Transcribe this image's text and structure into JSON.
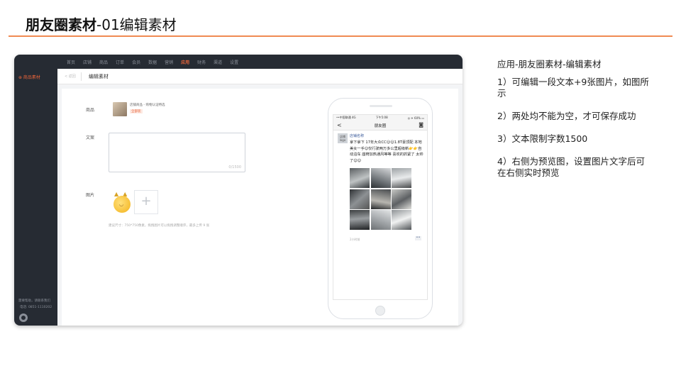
{
  "slide": {
    "title_bold": "朋友圈素材",
    "title_rest": "-01编辑素材"
  },
  "topnav": {
    "items": [
      "首页",
      "店铺",
      "商品",
      "订单",
      "会员",
      "数据",
      "营销",
      "应用",
      "财务",
      "渠道",
      "设置"
    ],
    "active_index": 7
  },
  "sidebar": {
    "item": "⊕ 商品素材",
    "footer_line1": "需要帮助，请联系我们",
    "footer_line2": "电话: 0851-1110202"
  },
  "breadcrumb": {
    "back": "< 返回",
    "title": "编辑素材"
  },
  "form": {
    "goods_label": "商品",
    "goods_name": "店铺商品 - 购物认证特选",
    "goods_tag": "全部装",
    "text_label": "文案",
    "text_value": "",
    "text_counter": "0/1500",
    "image_label": "图片",
    "add_symbol": "+",
    "image_hint": "建议尺寸：750*750像素，拖拽图片可以拖拽调整顺序，最多上传 9 张"
  },
  "preview": {
    "status_left": "••中国联通 4G",
    "status_time": "下午5:08",
    "status_right": "◎ ✈ 60% ▭",
    "nav_back": "<",
    "nav_title": "朋友圈",
    "nav_camera": "◙",
    "logo_text": "店铺 logo",
    "shop_name": "店铺名称",
    "post_text": "拿下拿下 17年大众CC😊😊1.8T豪顶配 本地美女一手😊仅行驶两万多公里超级新👉👉自动泊车 座椅加热通风等等 喜欢的抓紧了 太帅了😊😊",
    "photo_count": 9,
    "post_time": "2小时前",
    "more_button": "••"
  },
  "notes": {
    "heading": "应用-朋友圈素材-编辑素材",
    "items": [
      "1）可编辑一段文本+9张图片，如图所示",
      "2）两处均不能为空，才可保存成功",
      "3）文本限制字数1500",
      "4）右侧为预览图，设置图片文字后可在右侧实时预览"
    ]
  },
  "colors": {
    "accent": "#e8643a",
    "title_rule": "#f08a52",
    "dark_nav": "#262b33",
    "link_blue": "#3b5b9a"
  }
}
